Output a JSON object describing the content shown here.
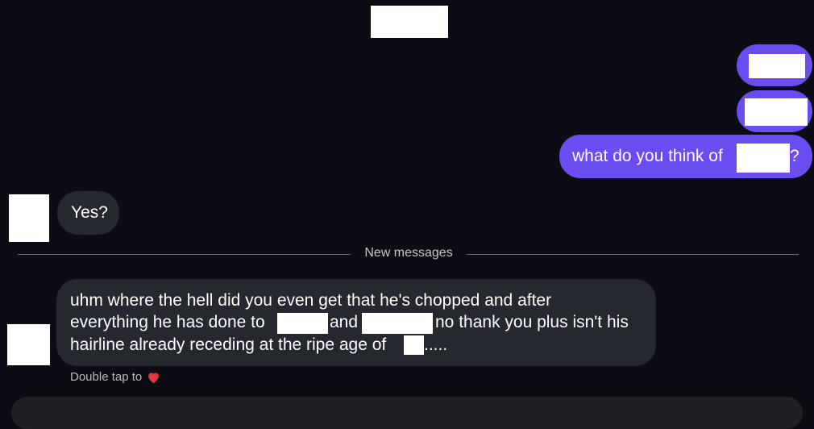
{
  "conversation": {
    "outgoing": {
      "question": {
        "before": "what do you think of",
        "after": "?"
      }
    },
    "incoming": {
      "reply_short": "Yes?",
      "reply_long": {
        "line1": "uhm where the hell did you even get that he's chopped and after",
        "line2_part1": "everything he has done to",
        "line2_part2": "and",
        "line2_part3": "no thank you plus isn't his",
        "line3_part1": "hairline already receding at the ripe age of",
        "line3_part2": "....."
      }
    },
    "divider_label": "New messages",
    "reaction_hint": "Double tap to",
    "reaction_icon": "heart-icon"
  },
  "colors": {
    "background": "#0c0c14",
    "outgoing_bubble": "#6a4cf0",
    "incoming_bubble": "#26282f",
    "heart": "#e0383e"
  }
}
